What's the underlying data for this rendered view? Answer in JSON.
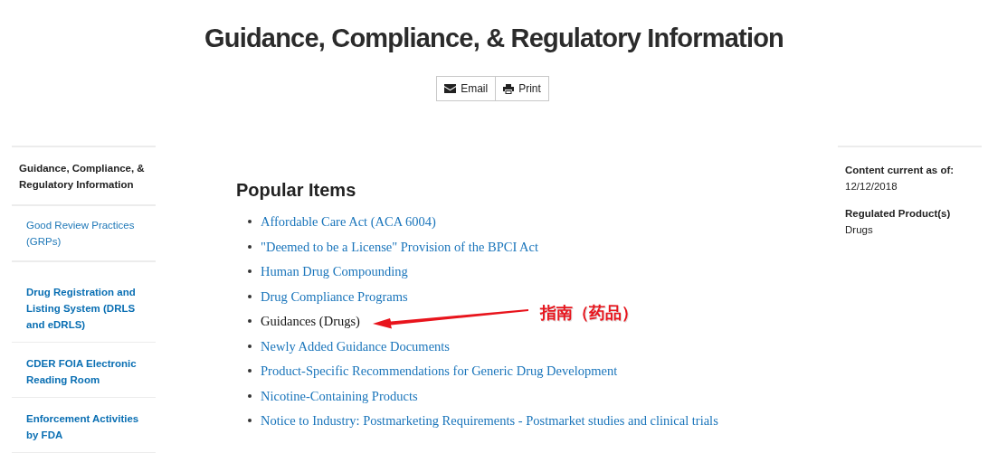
{
  "page_title": "Guidance, Compliance, & Regulatory Information",
  "share_buttons": [
    {
      "kind": "email",
      "label": "Email"
    },
    {
      "kind": "print",
      "label": "Print"
    }
  ],
  "sidebar": {
    "items": [
      {
        "kind": "current",
        "label": "Guidance, Compliance, & Regulatory Information"
      },
      {
        "kind": "child",
        "label": "Good Review Practices (GRPs)"
      },
      {
        "kind": "link",
        "label": "Drug Registration and Listing System (DRLS and eDRLS)"
      },
      {
        "kind": "link",
        "label": "CDER FOIA Electronic Reading Room"
      },
      {
        "kind": "link",
        "label": "Enforcement Activities by FDA"
      }
    ]
  },
  "popular_items": {
    "heading": "Popular Items",
    "items": [
      {
        "label": "Affordable Care Act (ACA 6004)",
        "highlighted": false
      },
      {
        "label": "\"Deemed to be a License\" Provision of the BPCI Act",
        "highlighted": false
      },
      {
        "label": "Human Drug Compounding",
        "highlighted": false
      },
      {
        "label": "Drug Compliance Programs",
        "highlighted": false
      },
      {
        "label": "Guidances (Drugs)",
        "highlighted": true
      },
      {
        "label": "Newly Added Guidance Documents",
        "highlighted": false
      },
      {
        "label": "Product-Specific Recommendations for Generic Drug Development",
        "highlighted": false
      },
      {
        "label": "Nicotine-Containing Products",
        "highlighted": false
      },
      {
        "label": "Notice to Industry: Postmarketing Requirements - Postmarket studies and clinical trials",
        "highlighted": false
      }
    ]
  },
  "annotation": {
    "text": "指南（药品）"
  },
  "info_panel": [
    {
      "label": "Content current as of:",
      "value": "12/12/2018"
    },
    {
      "label": "Regulated Product(s)",
      "value": "Drugs"
    }
  ]
}
